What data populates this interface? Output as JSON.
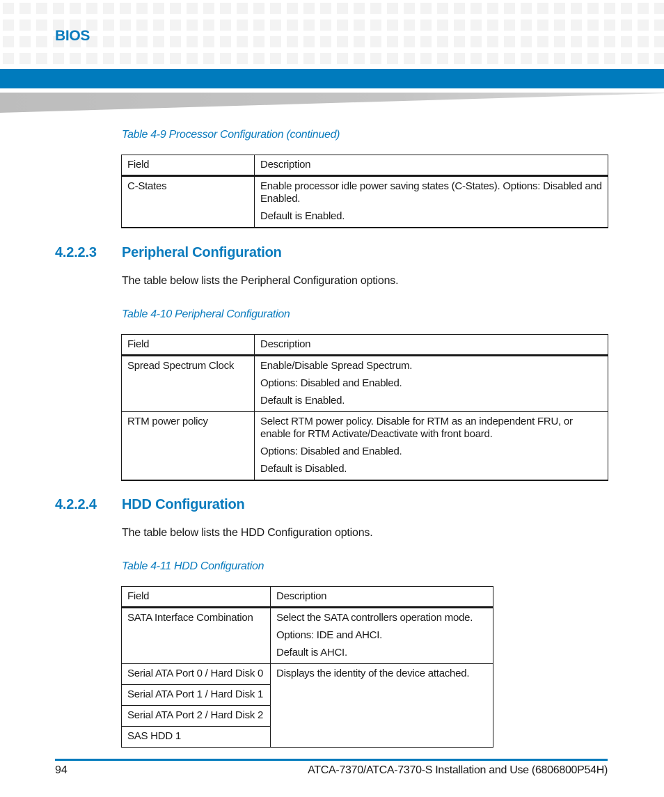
{
  "header": {
    "chapter": "BIOS",
    "colors": {
      "accent": "#007bbd",
      "heading": "#0a7bbd",
      "grid": "#f3f3f3",
      "wedge": "#bdbdbd"
    }
  },
  "table_4_9": {
    "caption": "Table 4-9 Processor Configuration (continued)",
    "columns": [
      "Field",
      "Description"
    ],
    "rows": [
      {
        "field": "C-States",
        "description": [
          "Enable processor idle power saving states (C-States). Options: Disabled and Enabled.",
          "Default is Enabled."
        ]
      }
    ]
  },
  "section_4_2_2_3": {
    "number": "4.2.2.3",
    "title": "Peripheral Configuration",
    "intro": "The table below lists the Peripheral Configuration options."
  },
  "table_4_10": {
    "caption": "Table 4-10 Peripheral Configuration",
    "columns": [
      "Field",
      "Description"
    ],
    "rows": [
      {
        "field": "Spread Spectrum Clock",
        "description": [
          "Enable/Disable Spread Spectrum.",
          "Options: Disabled and Enabled.",
          "Default is Enabled."
        ]
      },
      {
        "field": "RTM power policy",
        "description": [
          "Select RTM power policy. Disable for RTM as an independent FRU, or enable for RTM Activate/Deactivate with front board.",
          "Options: Disabled and Enabled.",
          "Default is Disabled."
        ]
      }
    ]
  },
  "section_4_2_2_4": {
    "number": "4.2.2.4",
    "title": "HDD Configuration",
    "intro": "The table below lists the HDD Configuration options."
  },
  "table_4_11": {
    "caption": "Table 4-11 HDD Configuration",
    "columns": [
      "Field",
      "Description"
    ],
    "rows": [
      {
        "field": "SATA Interface Combination",
        "description": [
          "Select the SATA controllers operation mode.",
          "Options: IDE and AHCI.",
          "Default is AHCI."
        ]
      },
      {
        "field": "Serial ATA Port 0 / Hard Disk 0",
        "description": [
          "Displays the identity of the device attached."
        ]
      },
      {
        "field": "Serial ATA Port 1 / Hard Disk 1"
      },
      {
        "field": "Serial ATA Port 2 / Hard Disk 2"
      },
      {
        "field": "SAS HDD 1"
      }
    ]
  },
  "footer": {
    "page_number": "94",
    "document_title": "ATCA-7370/ATCA-7370-S Installation and Use (6806800P54H)"
  }
}
